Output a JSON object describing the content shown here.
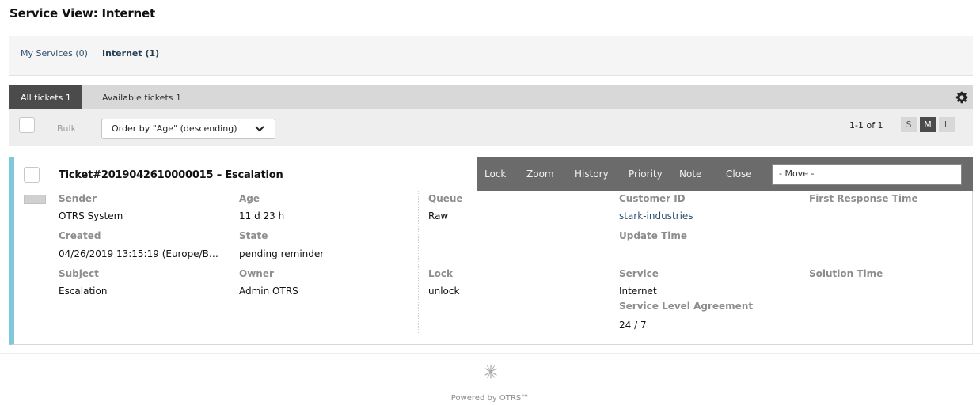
{
  "page": {
    "title": "Service View: Internet"
  },
  "service_nav": [
    {
      "label": "My Services (0)",
      "active": false
    },
    {
      "label": "Internet (1)",
      "active": true
    }
  ],
  "tabs": [
    {
      "label": "All tickets 1",
      "active": true
    },
    {
      "label": "Available tickets 1",
      "active": false
    }
  ],
  "toolbar": {
    "bulk_label": "Bulk",
    "order_by": "Order by \"Age\" (descending)",
    "pagination": "1-1 of 1",
    "view_sizes": [
      "S",
      "M",
      "L"
    ],
    "active_size": "M"
  },
  "ticket": {
    "title": "Ticket#2019042610000015 – Escalation",
    "actions": [
      "Lock",
      "Zoom",
      "History",
      "Priority",
      "Note",
      "Close"
    ],
    "move_placeholder": "- Move -",
    "fields": {
      "sender_label": "Sender",
      "sender": "OTRS System",
      "created_label": "Created",
      "created": "04/26/2019 13:15:19 (Europe/B…",
      "subject_label": "Subject",
      "subject": "Escalation",
      "age_label": "Age",
      "age": "11 d 23 h",
      "state_label": "State",
      "state": "pending reminder",
      "owner_label": "Owner",
      "owner": "Admin OTRS",
      "queue_label": "Queue",
      "queue": "Raw",
      "lock_label": "Lock",
      "lock": "unlock",
      "customer_id_label": "Customer ID",
      "customer_id": "stark-industries",
      "update_time_label": "Update Time",
      "service_label": "Service",
      "service": "Internet",
      "sla_label": "Service Level Agreement",
      "sla": "24 / 7",
      "first_response_label": "First Response Time",
      "solution_time_label": "Solution Time"
    },
    "accent_color": "#7ec8dc"
  },
  "footer": {
    "text": "Powered by OTRS™"
  }
}
